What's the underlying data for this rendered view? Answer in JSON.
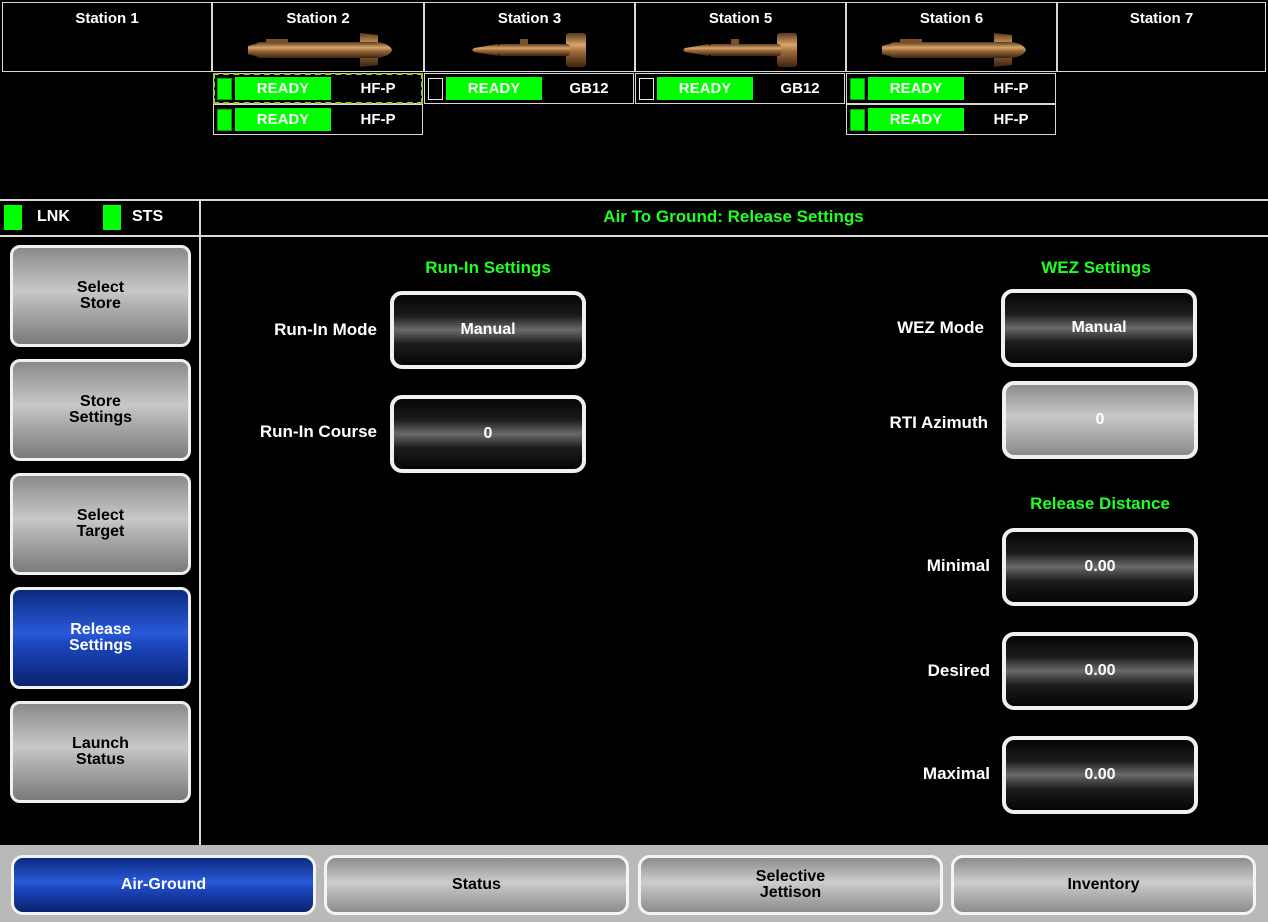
{
  "stations": [
    {
      "name": "Station 1",
      "weapon": "none"
    },
    {
      "name": "Station 2",
      "weapon": "missile"
    },
    {
      "name": "Station 3",
      "weapon": "bomb"
    },
    {
      "name": "Station 5",
      "weapon": "bomb"
    },
    {
      "name": "Station 6",
      "weapon": "missile"
    },
    {
      "name": "Station 7",
      "weapon": "none"
    }
  ],
  "stores": {
    "s2_r1": {
      "status": "READY",
      "type": "HF-P"
    },
    "s2_r2": {
      "status": "READY",
      "type": "HF-P"
    },
    "s3_r1": {
      "status": "READY",
      "type": "GB12"
    },
    "s5_r1": {
      "status": "READY",
      "type": "GB12"
    },
    "s6_r1": {
      "status": "READY",
      "type": "HF-P"
    },
    "s6_r2": {
      "status": "READY",
      "type": "HF-P"
    }
  },
  "indicators": {
    "lnk": "LNK",
    "sts": "STS"
  },
  "page_title": "Air To Ground: Release Settings",
  "side_menu": [
    {
      "label": "Select\nStore",
      "active": false
    },
    {
      "label": "Store\nSettings",
      "active": false
    },
    {
      "label": "Select\nTarget",
      "active": false
    },
    {
      "label": "Release\nSettings",
      "active": true
    },
    {
      "label": "Launch\nStatus",
      "active": false
    }
  ],
  "run_in": {
    "title": "Run-In Settings",
    "mode_label": "Run-In Mode",
    "mode_value": "Manual",
    "course_label": "Run-In Course",
    "course_value": "0"
  },
  "wez": {
    "title": "WEZ Settings",
    "mode_label": "WEZ Mode",
    "mode_value": "Manual",
    "rti_label": "RTI Azimuth",
    "rti_value": "0"
  },
  "release_distance": {
    "title": "Release Distance",
    "minimal_label": "Minimal",
    "minimal_value": "0.00",
    "desired_label": "Desired",
    "desired_value": "0.00",
    "maximal_label": "Maximal",
    "maximal_value": "0.00"
  },
  "bottom_tabs": [
    {
      "label": "Air-Ground",
      "active": true
    },
    {
      "label": "Status",
      "active": false
    },
    {
      "label": "Selective\nJettison",
      "active": false
    },
    {
      "label": "Inventory",
      "active": false
    }
  ],
  "colors": {
    "ready": "#00ff00",
    "title_green": "#22ff22",
    "active_blue": "#1c48c0"
  }
}
